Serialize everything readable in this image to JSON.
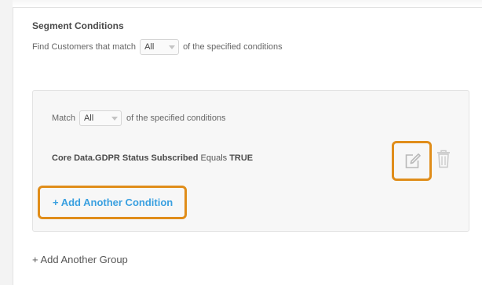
{
  "segment": {
    "title": "Segment Conditions",
    "find_prefix": "Find Customers that match",
    "find_select_value": "All",
    "find_suffix": "of the specified conditions"
  },
  "group": {
    "match_label": "Match",
    "match_select_value": "All",
    "match_suffix": "of the specified conditions",
    "condition": {
      "field": "Core Data.GDPR Status Subscribed",
      "operator": "Equals",
      "value": "TRUE"
    },
    "edit_icon": "edit-icon",
    "delete_icon": "trash-icon",
    "add_condition_label": "+ Add Another Condition"
  },
  "add_group_label": "+ Add Another Group",
  "colors": {
    "highlight": "#e08d1a",
    "link": "#3aa0e0",
    "text": "#555555"
  }
}
